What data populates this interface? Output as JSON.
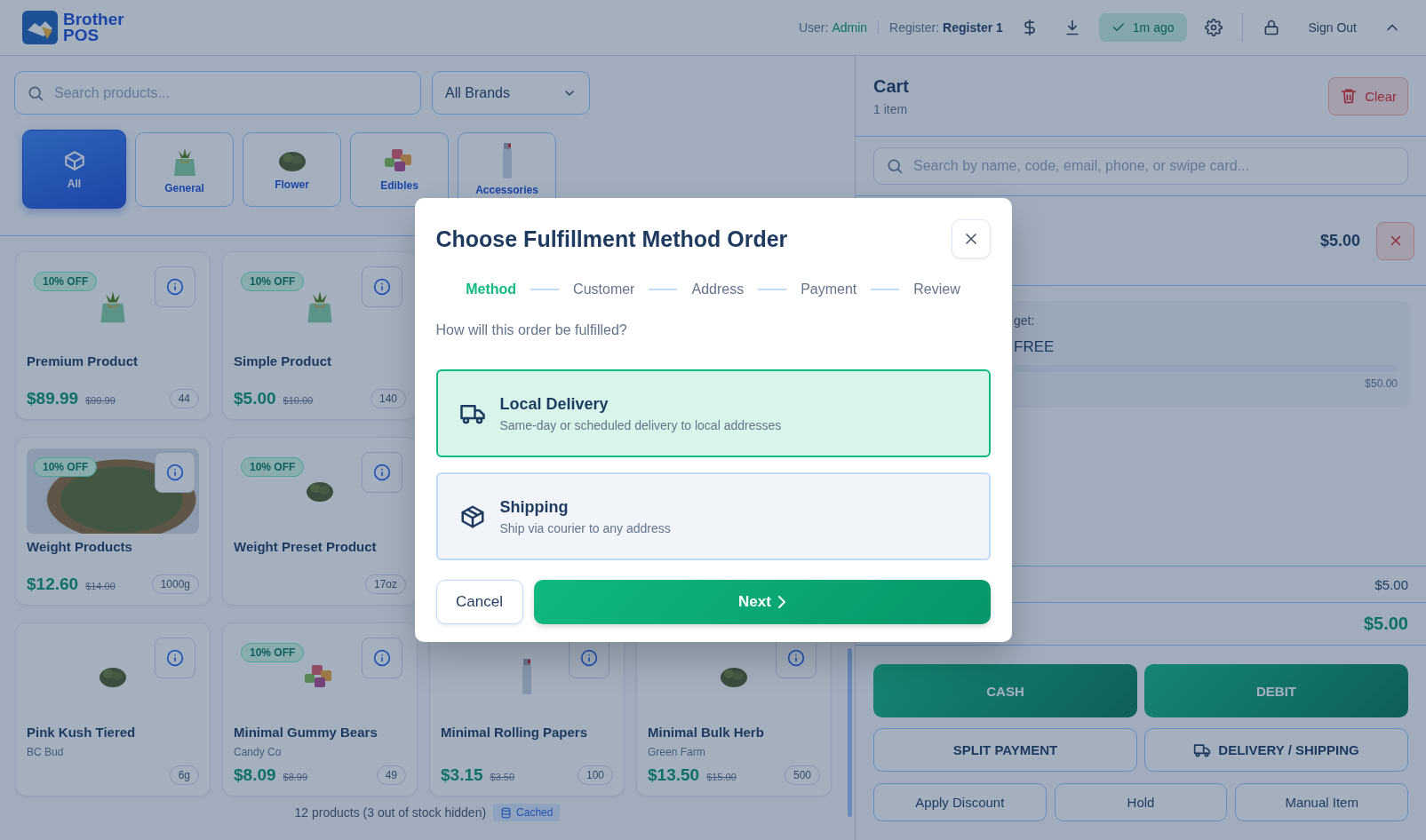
{
  "header": {
    "logo_text": [
      "Brother",
      "POS"
    ],
    "user_label": "User:",
    "user": "Admin",
    "register_label": "Register:",
    "register": "Register 1",
    "sync": "1m ago",
    "sign_out": "Sign Out"
  },
  "products_panel": {
    "search_placeholder": "Search products...",
    "brand_filter": "All Brands",
    "categories": [
      {
        "label": "All",
        "selected": true,
        "kind": "cube"
      },
      {
        "label": "General",
        "selected": false,
        "kind": "bag"
      },
      {
        "label": "Flower",
        "selected": false,
        "kind": "bud"
      },
      {
        "label": "Edibles",
        "selected": false,
        "kind": "gummies"
      },
      {
        "label": "Accessories",
        "selected": false,
        "kind": "lighter"
      }
    ],
    "product_rows": [
      [
        {
          "name": "Premium Product",
          "discount": "10% OFF",
          "kind": "bag",
          "price": "$89.99",
          "original_price": "$99.99",
          "stock": "44"
        },
        {
          "name": "Simple Product",
          "discount": "10% OFF",
          "kind": "bag",
          "price": "$5.00",
          "original_price": "$10.00",
          "stock": "140"
        }
      ],
      [
        {
          "name": "Weight Products",
          "discount": "10% OFF",
          "kind": "photo",
          "price": "$12.60",
          "original_price": "$14.00",
          "stock": "1000g"
        },
        {
          "name": "Weight Preset Product",
          "discount": "10% OFF",
          "kind": "bud",
          "stock": "17oz"
        }
      ],
      [
        {
          "name": "Pink Kush Tiered",
          "brand": "BC Bud",
          "kind": "bud",
          "stock": "6g"
        },
        {
          "name": "Minimal Gummy Bears",
          "brand": "Candy Co",
          "discount": "10% OFF",
          "kind": "gummies",
          "price": "$8.09",
          "original_price": "$8.99",
          "stock": "49"
        },
        {
          "name": "Minimal Rolling Papers",
          "kind": "lighter",
          "price": "$3.15",
          "original_price": "$3.50",
          "stock": "100"
        },
        {
          "name": "Minimal Bulk Herb",
          "brand": "Green Farm",
          "kind": "bud",
          "price": "$13.50",
          "original_price": "$15.00",
          "stock": "500"
        }
      ]
    ],
    "footer": {
      "count": "12 products (3 out of stock hidden)",
      "badge": "Cached"
    }
  },
  "cart": {
    "title": "Cart",
    "count": "1 item",
    "clear": "Clear",
    "search_placeholder": "Search by name, code, email, phone, or swipe card...",
    "item_price": "$5.00",
    "promo_label": "get:",
    "promo_value": "FREE",
    "promo_target": "$50.00",
    "subtotal": "$5.00",
    "total": "$5.00",
    "payment_buttons": [
      "CASH",
      "DEBIT"
    ],
    "secondary_buttons": [
      {
        "label": "SPLIT PAYMENT",
        "kind": "plain"
      },
      {
        "label": "DELIVERY / SHIPPING",
        "kind": "truck"
      }
    ],
    "actions": [
      "Apply Discount",
      "Hold",
      "Manual Item"
    ]
  },
  "modal": {
    "title": "Choose Fulfillment Method Order",
    "steps": [
      {
        "label": "Method",
        "selected": true
      },
      {
        "label": "Customer",
        "selected": false
      },
      {
        "label": "Address",
        "selected": false
      },
      {
        "label": "Payment",
        "selected": false
      },
      {
        "label": "Review",
        "selected": false
      }
    ],
    "question": "How will this order be fulfilled?",
    "options": [
      {
        "title": "Local Delivery",
        "description": "Same-day or scheduled delivery to local addresses",
        "kind": "truck",
        "selected": true
      },
      {
        "title": "Shipping",
        "description": "Ship via courier to any address",
        "kind": "box",
        "selected": false
      }
    ],
    "cancel": "Cancel",
    "next": "Next"
  }
}
